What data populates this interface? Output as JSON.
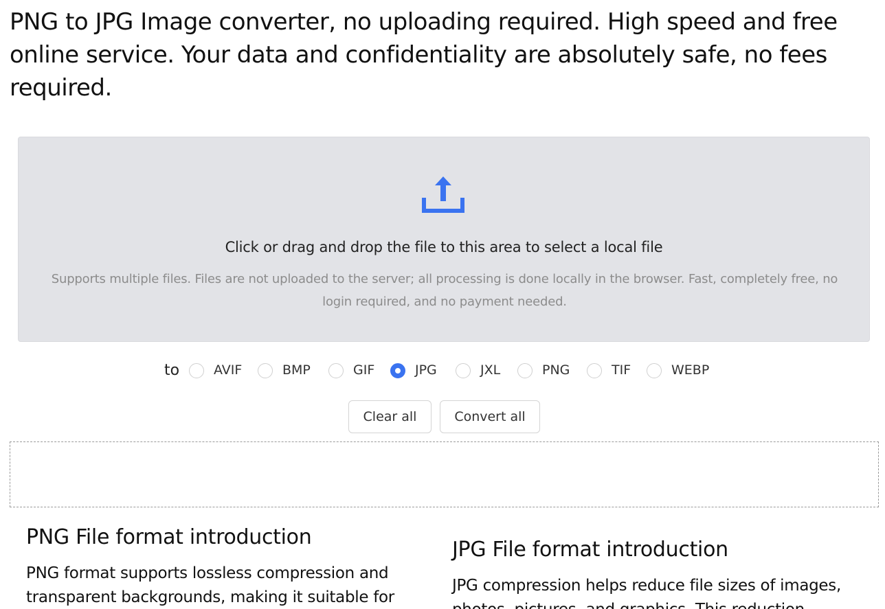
{
  "header": {
    "headline": "PNG to JPG Image converter, no uploading required. High speed and free online service. Your data and confidentiality are absolutely safe, no fees required."
  },
  "dropzone": {
    "icon": "upload-icon",
    "title": "Click or drag and drop the file to this area to select a local file",
    "subtitle": "Supports multiple files. Files are not uploaded to the server; all processing is done locally in the browser. Fast, completely free, no login required, and no payment needed."
  },
  "format_selector": {
    "prefix": "to",
    "options": [
      "AVIF",
      "BMP",
      "GIF",
      "JPG",
      "JXL",
      "PNG",
      "TIF",
      "WEBP"
    ],
    "selected": "JPG"
  },
  "actions": {
    "clear_label": "Clear all",
    "convert_label": "Convert all"
  },
  "intro": {
    "png": {
      "title": "PNG File format introduction",
      "text": "PNG format supports lossless compression and transparent backgrounds, making it suitable for"
    },
    "jpg": {
      "title": "JPG File format introduction",
      "text": "JPG compression helps reduce file sizes of images, photos, pictures, and graphics. This reduction"
    }
  },
  "colors": {
    "accent": "#3a73f0",
    "dropzone_bg": "#e2e3e7"
  }
}
